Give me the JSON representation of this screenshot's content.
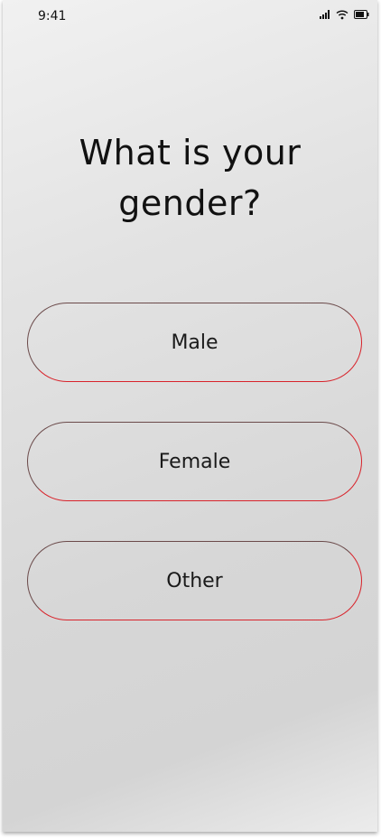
{
  "status_bar": {
    "time": "9:41",
    "icons": [
      "signal-icon",
      "wifi-icon",
      "battery-icon"
    ]
  },
  "question": {
    "line1": "What is your",
    "line2": "gender?"
  },
  "options": [
    {
      "label": "Male"
    },
    {
      "label": "Female"
    },
    {
      "label": "Other"
    }
  ],
  "colors": {
    "option_border": "#d8232b",
    "text": "#111111"
  }
}
